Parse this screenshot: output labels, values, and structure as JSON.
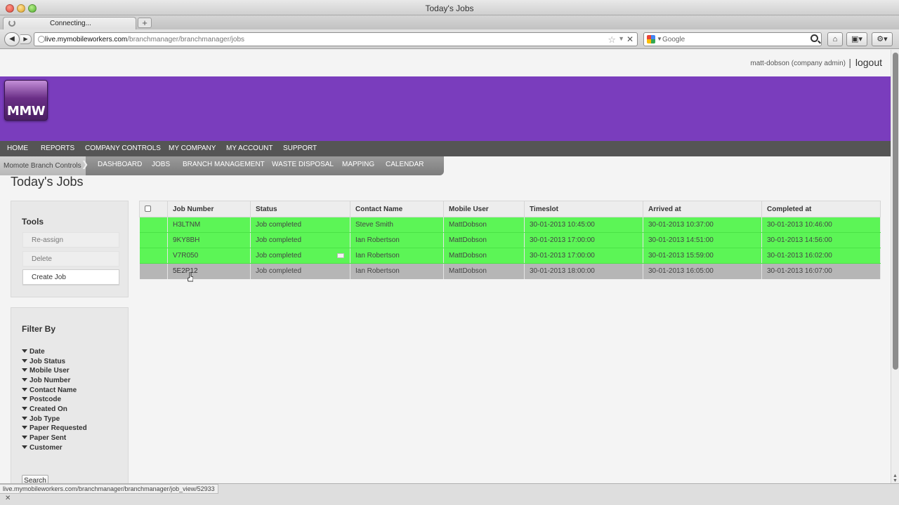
{
  "window": {
    "title": "Today's Jobs"
  },
  "browser": {
    "tab_label": "Connecting...",
    "new_tab": "+",
    "url_host": "live.mymobileworkers.com",
    "url_path": "/branchmanager/branchmanager/jobs",
    "search_placeholder": "Google",
    "status_url": "live.mymobileworkers.com/branchmanager/branchmanager/job_view/52933"
  },
  "user": {
    "info": "matt-dobson (company admin)",
    "separator": "|",
    "logout": "logout"
  },
  "logo": {
    "text": "MMW"
  },
  "main_nav": [
    "HOME",
    "REPORTS",
    "COMPANY CONTROLS",
    "MY COMPANY",
    "MY ACCOUNT",
    "SUPPORT"
  ],
  "sub_nav": {
    "label": "Momote Branch Controls",
    "items": [
      "DASHBOARD",
      "JOBS",
      "BRANCH MANAGEMENT",
      "WASTE DISPOSAL",
      "MAPPING",
      "CALENDAR"
    ]
  },
  "page_title": "Today's Jobs",
  "tools": {
    "title": "Tools",
    "reassign": "Re-assign",
    "delete": "Delete",
    "create": "Create Job"
  },
  "filter": {
    "title": "Filter By",
    "items": [
      "Date",
      "Job Status",
      "Mobile User",
      "Job Number",
      "Contact Name",
      "Postcode",
      "Created On",
      "Job Type",
      "Paper Requested",
      "Paper Sent",
      "Customer"
    ],
    "search": "Search"
  },
  "table": {
    "headers": [
      "Job Number",
      "Status",
      "Contact Name",
      "Mobile User",
      "Timeslot",
      "Arrived at",
      "Completed at"
    ],
    "rows": [
      {
        "job": "H3LTNM",
        "status": "Job completed",
        "contact": "Steve Smith",
        "user": "MattDobson",
        "timeslot": "30-01-2013 10:45:00",
        "arrived": "30-01-2013 10:37:00",
        "completed": "30-01-2013 10:46:00",
        "row_color": "#5cf556"
      },
      {
        "job": "9KY8BH",
        "status": "Job completed",
        "contact": "Ian Robertson",
        "user": "MattDobson",
        "timeslot": "30-01-2013 17:00:00",
        "arrived": "30-01-2013 14:51:00",
        "completed": "30-01-2013 14:56:00",
        "row_color": "#5cf556"
      },
      {
        "job": "V7R050",
        "status": "Job completed",
        "contact": "Ian Robertson",
        "user": "MattDobson",
        "timeslot": "30-01-2013 17:00:00",
        "arrived": "30-01-2013 15:59:00",
        "completed": "30-01-2013 16:02:00",
        "row_color": "#5cf556",
        "has_message": true
      },
      {
        "job": "5E2P12",
        "status": "Job completed",
        "contact": "Ian Robertson",
        "user": "MattDobson",
        "timeslot": "30-01-2013 18:00:00",
        "arrived": "30-01-2013 16:05:00",
        "completed": "30-01-2013 16:07:00",
        "row_color": "#b6b6b6"
      }
    ]
  },
  "colors": {
    "banner": "#7a3dbd",
    "nav": "#555555",
    "completed_row": "#5cf556",
    "hover_row": "#b6b6b6"
  }
}
